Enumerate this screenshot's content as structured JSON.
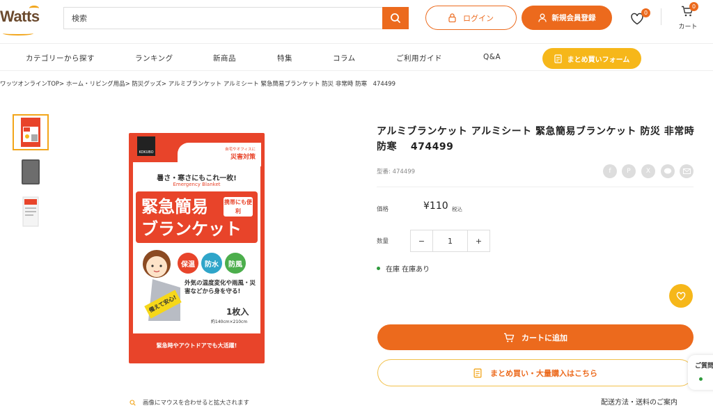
{
  "header": {
    "logo_text": "Watts",
    "search_placeholder": "検索",
    "login_label": "ログイン",
    "register_label": "新規会員登録",
    "wishlist_count": "0",
    "cart_count": "0",
    "cart_label": "カート"
  },
  "nav": {
    "items": [
      "カテゴリーから探す",
      "ランキング",
      "新商品",
      "特集",
      "コラム",
      "ご利用ガイド",
      "Q&A"
    ],
    "bulk_form_label": "まとめ買いフォーム"
  },
  "breadcrumb": "ワッツオンラインTOP> ホーム・リビング用品> 防災グッズ> アルミブランケット アルミシート 緊急簡易ブランケット 防災 非常時 防寒　474499",
  "gallery": {
    "zoom_hint": "画像にマウスを合わせると拡大されます",
    "package": {
      "brand": "KOKUBO",
      "corner_note": "自宅やオフィスに",
      "corner_title": "災害対策",
      "tagline": "暑さ・寒さにもこれ一枚!",
      "english": "Emergency Blanket",
      "title_1": "緊急簡易",
      "title_2": "ブランケット",
      "portable": "携帯にも便利",
      "feature_1": "保温",
      "feature_2": "防水",
      "feature_3": "防風",
      "desc": "外気の温度変化や雨風・災害などから身を守る!",
      "sticker": "備えて安心!",
      "count": "1枚入",
      "size": "約140cm×210cm",
      "footer": "緊急時やアウトドアでも大活躍!"
    }
  },
  "product": {
    "title": "アルミブランケット アルミシート 緊急簡易ブランケット 防災 非常時 防寒　 474499",
    "sku": "型番: 474499",
    "price_label": "価格",
    "price": "¥110",
    "tax_note": "税込",
    "qty_label": "数量",
    "qty_minus": "−",
    "qty_value": "1",
    "qty_plus": "+",
    "stock": "在庫 在庫あり",
    "add_to_cart": "カートに追加",
    "bulk_buy": "まとめ買い・大量購入はこちら",
    "shipping_link": "配送方法・送料のご案内"
  },
  "side_popup": "ご質問",
  "colors": {
    "orange": "#ec6a1d",
    "yellow": "#f6b71a",
    "stock_green": "#2e9a3c"
  }
}
